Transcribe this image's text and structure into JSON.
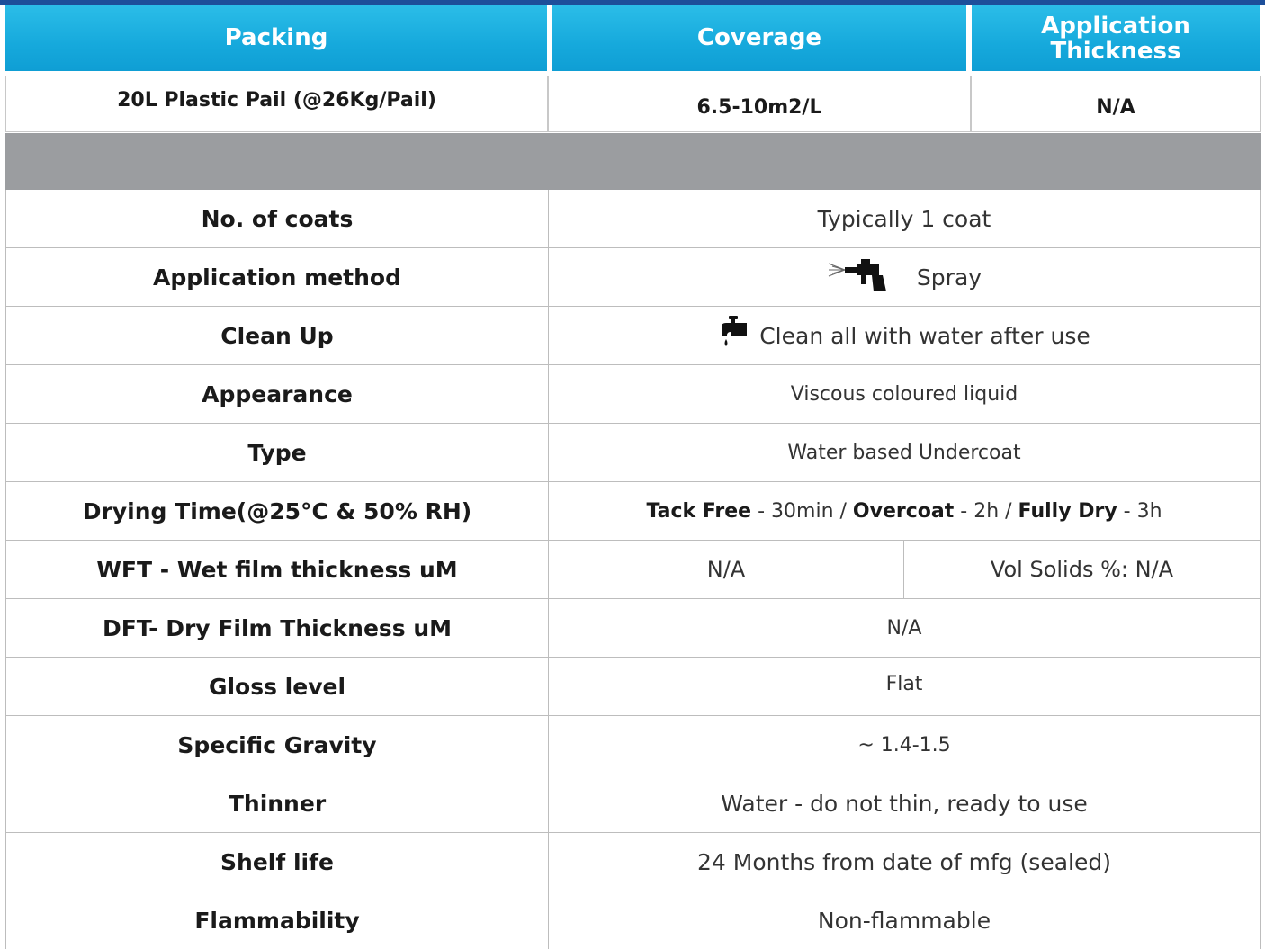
{
  "header": {
    "packing": "Packing",
    "coverage": "Coverage",
    "application_thickness_line1": "Application",
    "application_thickness_line2": "Thickness"
  },
  "packing_row": {
    "packing": "20L Plastic Pail (@26Kg/Pail)",
    "coverage": "6.5-10m2/L",
    "application_thickness": "N/A"
  },
  "specs": {
    "coats": {
      "label": "No. of coats",
      "value": "Typically 1 coat"
    },
    "application_method": {
      "label": "Application method",
      "value": "Spray",
      "icon": "spray-gun-icon"
    },
    "clean_up": {
      "label": "Clean Up",
      "value": "Clean all with water after use",
      "icon": "water-tap-icon"
    },
    "appearance": {
      "label": "Appearance",
      "value": "Viscous coloured liquid"
    },
    "type": {
      "label": "Type",
      "value": "Water based Undercoat"
    },
    "drying_time": {
      "label": "Drying Time(@25°C & 50% RH)",
      "tack_free_label": "Tack Free",
      "tack_free_value": " - 30min / ",
      "overcoat_label": "Overcoat",
      "overcoat_value": " - 2h / ",
      "fully_dry_label": "Fully Dry",
      "fully_dry_value": " - 3h"
    },
    "wft": {
      "label": "WFT - Wet film thickness uM",
      "value": "N/A",
      "vol_solids": "Vol Solids %: N/A"
    },
    "dft": {
      "label": "DFT- Dry Film Thickness uM",
      "value": "N/A"
    },
    "gloss": {
      "label": "Gloss level",
      "value": "Flat"
    },
    "specific_gravity": {
      "label": "Specific Gravity",
      "value": "~ 1.4-1.5"
    },
    "thinner": {
      "label": "Thinner",
      "value": "Water - do not thin, ready to use"
    },
    "shelf_life": {
      "label": "Shelf life",
      "value": "24 Months from date of mfg (sealed)"
    },
    "flammability": {
      "label": "Flammability",
      "value": "Non-flammable"
    }
  },
  "colors": {
    "header_blue": "#16a9dc",
    "top_rule": "#1d4f9a",
    "grey_band": "#9b9da0"
  }
}
